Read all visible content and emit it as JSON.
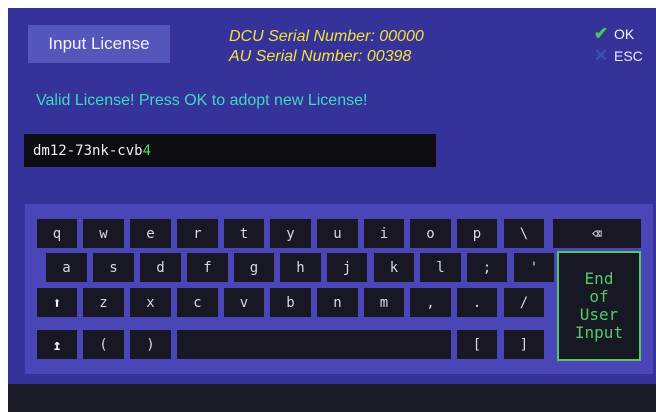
{
  "header": {
    "title": "Input License",
    "dcu_serial": "DCU Serial Number: 00000",
    "au_serial": "AU Serial Number: 00398",
    "ok_label": "OK",
    "esc_label": "ESC"
  },
  "status_message": "Valid License! Press OK to adopt new License!",
  "license_input": {
    "value_prefix": "dm12-73nk-cvb",
    "value_last_char": "4"
  },
  "keyboard": {
    "row1": [
      "q",
      "w",
      "e",
      "r",
      "t",
      "y",
      "u",
      "i",
      "o",
      "p",
      "\\"
    ],
    "backspace_symbol": "⌫",
    "row2": [
      "a",
      "s",
      "d",
      "f",
      "g",
      "h",
      "j",
      "k",
      "l",
      ";",
      "'"
    ],
    "shift_symbol": "⬆",
    "row3": [
      "z",
      "x",
      "c",
      "v",
      "b",
      "n",
      "m",
      ",",
      ".",
      "/"
    ],
    "caps_symbol": "↥",
    "row4_left": [
      "(",
      ")"
    ],
    "row4_right": [
      "[",
      "]"
    ],
    "end_label": [
      "End",
      "of",
      "User",
      "Input"
    ]
  },
  "colors": {
    "background": "#35339a",
    "keyboard_panel": "#4b46b8",
    "key": "#181825",
    "serial_text": "#f3e13a",
    "status_text": "#3ed9c2",
    "end_key_accent": "#57c767",
    "ok_check": "#46c85a"
  }
}
